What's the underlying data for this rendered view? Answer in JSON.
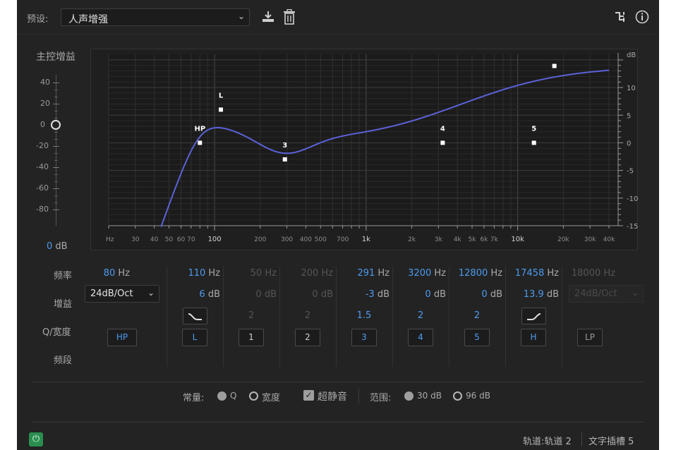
{
  "header": {
    "preset_label": "预设:",
    "preset_value": "人声增强",
    "icons": [
      "download-icon",
      "trash-icon",
      "routing-icon",
      "info-icon"
    ]
  },
  "master": {
    "label": "主控增益",
    "ticks": [
      "40",
      "20",
      "0",
      "-20",
      "-40",
      "-60",
      "-80"
    ],
    "value": "0",
    "unit": "dB",
    "level": 0
  },
  "graph": {
    "x_ticks": [
      "Hz",
      "30",
      "40",
      "50",
      "60",
      "70",
      "100",
      "200",
      "300",
      "400",
      "500",
      "700",
      "1k",
      "2k",
      "3k",
      "4k",
      "5k",
      "6k",
      "7k",
      "10k",
      "20k",
      "30k",
      "40k"
    ],
    "y_unit": "dB",
    "y_ticks": [
      "10",
      "5",
      "0",
      "-5",
      "-10",
      "-15"
    ],
    "nodes": [
      {
        "label": "HP",
        "freq": 80,
        "gain": 0
      },
      {
        "label": "L",
        "freq": 110,
        "gain": 6
      },
      {
        "label": "3",
        "freq": 291,
        "gain": -3
      },
      {
        "label": "4",
        "freq": 3200,
        "gain": 0
      },
      {
        "label": "5",
        "freq": 12800,
        "gain": 0
      },
      {
        "label": "",
        "freq": 17458,
        "gain": 13.9
      }
    ],
    "colors": {
      "curve": "#5b62d8",
      "node": "#ffffff"
    }
  },
  "rows": {
    "freq": "频率",
    "gain": "增益",
    "q": "Q/宽度",
    "band": "频段"
  },
  "hp_slope": "24dB/Oct",
  "lp_slope": "24dB/Oct",
  "bands": [
    {
      "freq": "80",
      "unit": "Hz",
      "gain": "",
      "gain_unit": "",
      "q": "",
      "button": "HP",
      "enabled": true,
      "shape": "",
      "text_color": "blue"
    },
    {
      "freq": "110",
      "unit": "Hz",
      "gain": "6",
      "gain_unit": "dB",
      "q": "",
      "button": "L",
      "enabled": true,
      "shape": "low-shelf-icon",
      "text_color": "blue"
    },
    {
      "freq": "50",
      "unit": "Hz",
      "gain": "0",
      "gain_unit": "dB",
      "q": "2",
      "button": "1",
      "enabled": false,
      "shape": "",
      "text_color": "dim"
    },
    {
      "freq": "200",
      "unit": "Hz",
      "gain": "0",
      "gain_unit": "dB",
      "q": "2",
      "button": "2",
      "enabled": false,
      "shape": "",
      "text_color": "dim"
    },
    {
      "freq": "291",
      "unit": "Hz",
      "gain": "-3",
      "gain_unit": "dB",
      "q": "1.5",
      "button": "3",
      "enabled": true,
      "shape": "",
      "text_color": "blue"
    },
    {
      "freq": "3200",
      "unit": "Hz",
      "gain": "0",
      "gain_unit": "dB",
      "q": "2",
      "button": "4",
      "enabled": true,
      "shape": "",
      "text_color": "blue"
    },
    {
      "freq": "12800",
      "unit": "Hz",
      "gain": "0",
      "gain_unit": "dB",
      "q": "2",
      "button": "5",
      "enabled": true,
      "shape": "",
      "text_color": "blue"
    },
    {
      "freq": "17458",
      "unit": "Hz",
      "gain": "13.9",
      "gain_unit": "dB",
      "q": "",
      "button": "H",
      "enabled": true,
      "shape": "high-shelf-icon",
      "text_color": "blue"
    },
    {
      "freq": "18000",
      "unit": "Hz",
      "gain": "",
      "gain_unit": "",
      "q": "",
      "button": "LP",
      "enabled": false,
      "shape": "",
      "text_color": "dim"
    }
  ],
  "options": {
    "constant_label": "常量:",
    "q_label": "Q",
    "width_label": "宽度",
    "ultra_quiet_label": "超静音",
    "range_label": "范围:",
    "range_30": "30 dB",
    "range_96": "96 dB"
  },
  "footer": {
    "track": "轨道:轨道 2",
    "slot": "文字插槽 5"
  }
}
